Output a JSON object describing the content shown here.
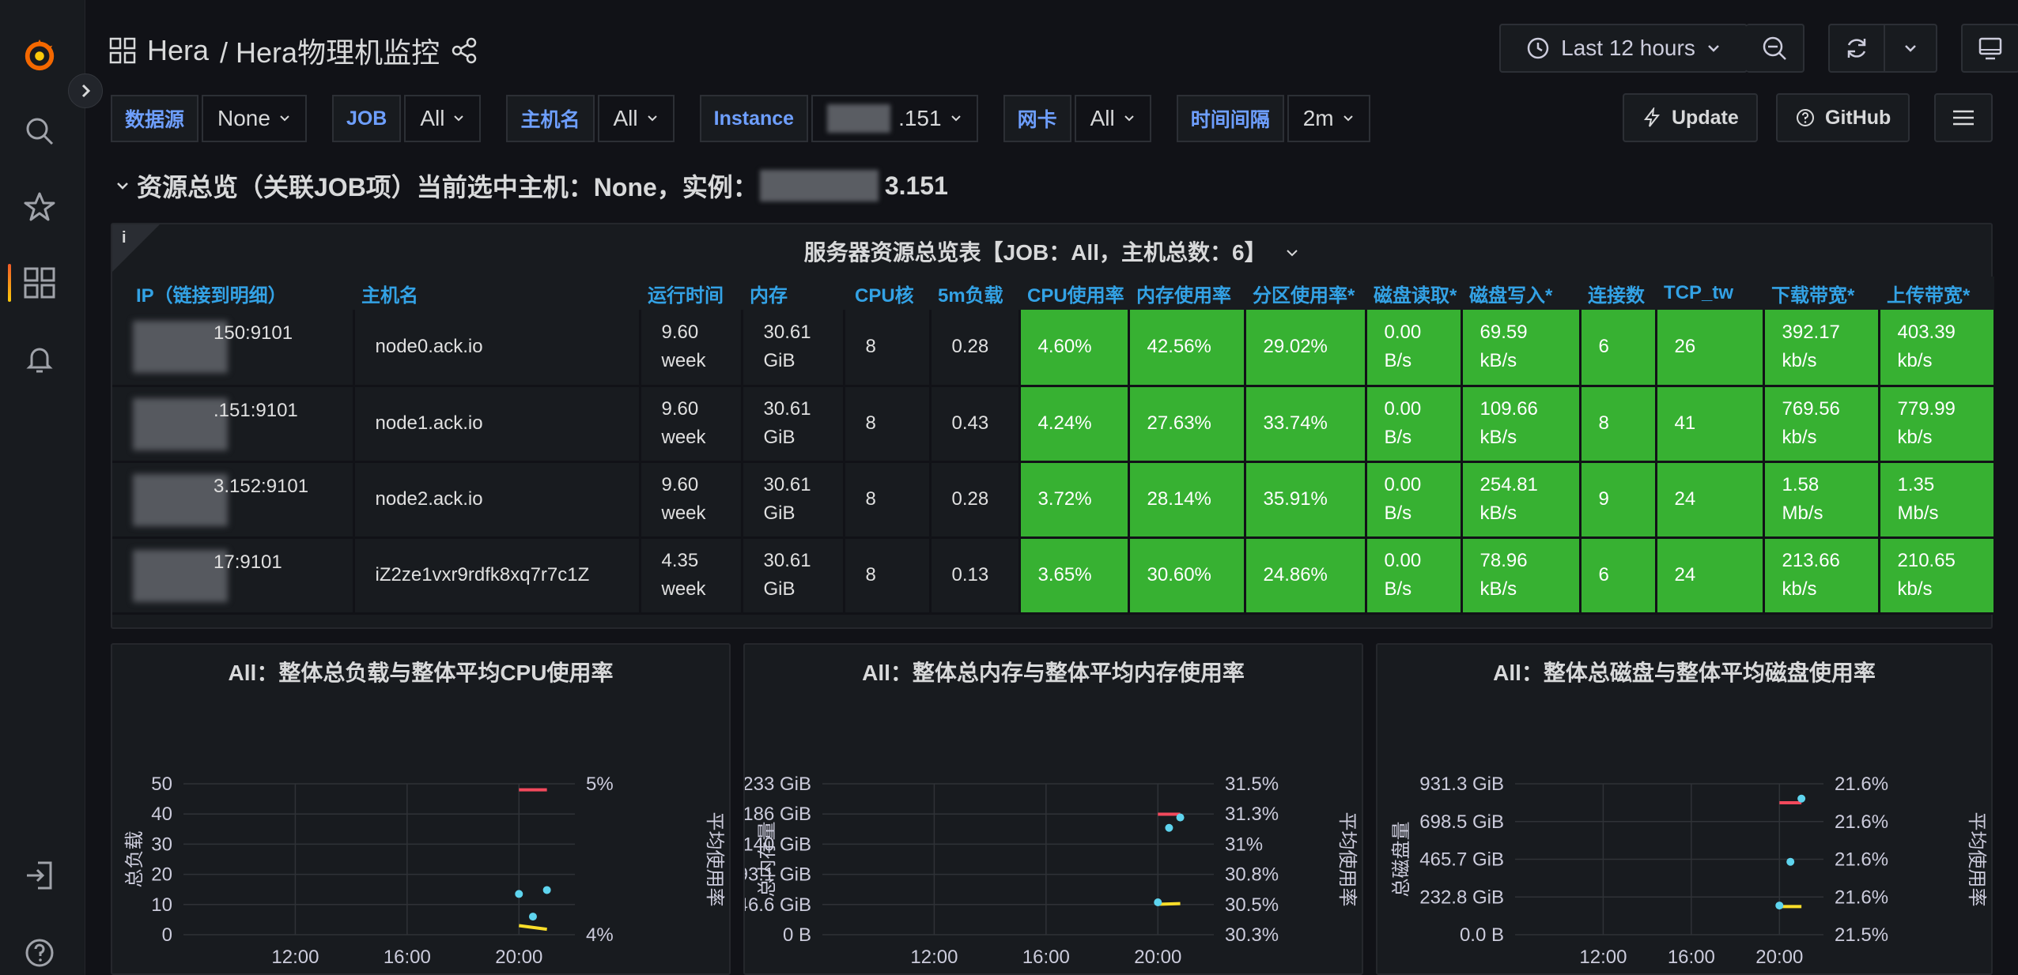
{
  "header": {
    "dashboard_folder": "Hera",
    "dashboard_title": "/ Hera物理机监控",
    "time_range": "Last 12 hours"
  },
  "variables": [
    {
      "label": "数据源",
      "value": "None"
    },
    {
      "label": "JOB",
      "value": "All"
    },
    {
      "label": "主机名",
      "value": "All"
    },
    {
      "label": "Instance",
      "value": ".151"
    },
    {
      "label": "网卡",
      "value": "All"
    },
    {
      "label": "时间间隔",
      "value": "2m"
    }
  ],
  "actions": {
    "update": "Update",
    "github": "GitHub"
  },
  "row": {
    "title_prefix": "资源总览（关联JOB项）当前选中主机：None，实例：",
    "title_suffix": "3.151"
  },
  "table": {
    "title": "服务器资源总览表【JOB：All，主机总数：6】",
    "columns": [
      "IP（链接到明细）",
      "主机名",
      "运行时间",
      "内存",
      "CPU核",
      "5m负载",
      "CPU使用率",
      "内存使用率",
      "分区使用率*",
      "磁盘读取*",
      "磁盘写入*",
      "连接数",
      "TCP_tw",
      "下载带宽*",
      "上传带宽*"
    ],
    "rows": [
      {
        "ip": "150:9101",
        "host": "node0.ack.io",
        "uptime_1": "9.60",
        "uptime_2": "week",
        "mem_1": "30.61",
        "mem_2": "GiB",
        "cpu": "8",
        "load": "0.28",
        "cpu_pct": "4.60%",
        "mem_pct": "42.56%",
        "part_pct": "29.02%",
        "rd_1": "0.00",
        "rd_2": "B/s",
        "wr_1": "69.59",
        "wr_2": "kB/s",
        "conn": "6",
        "tw": "26",
        "dl_1": "392.17",
        "dl_2": "kb/s",
        "ul_1": "403.39",
        "ul_2": "kb/s"
      },
      {
        "ip": ".151:9101",
        "host": "node1.ack.io",
        "uptime_1": "9.60",
        "uptime_2": "week",
        "mem_1": "30.61",
        "mem_2": "GiB",
        "cpu": "8",
        "load": "0.43",
        "cpu_pct": "4.24%",
        "mem_pct": "27.63%",
        "part_pct": "33.74%",
        "rd_1": "0.00",
        "rd_2": "B/s",
        "wr_1": "109.66",
        "wr_2": "kB/s",
        "conn": "8",
        "tw": "41",
        "dl_1": "769.56",
        "dl_2": "kb/s",
        "ul_1": "779.99",
        "ul_2": "kb/s"
      },
      {
        "ip": "3.152:9101",
        "host": "node2.ack.io",
        "uptime_1": "9.60",
        "uptime_2": "week",
        "mem_1": "30.61",
        "mem_2": "GiB",
        "cpu": "8",
        "load": "0.28",
        "cpu_pct": "3.72%",
        "mem_pct": "28.14%",
        "part_pct": "35.91%",
        "rd_1": "0.00",
        "rd_2": "B/s",
        "wr_1": "254.81",
        "wr_2": "kB/s",
        "conn": "9",
        "tw": "24",
        "dl_1": "1.58",
        "dl_2": "Mb/s",
        "ul_1": "1.35",
        "ul_2": "Mb/s"
      },
      {
        "ip": "17:9101",
        "host": "iZ2ze1vxr9rdfk8xq7r7c1Z",
        "uptime_1": "4.35",
        "uptime_2": "week",
        "mem_1": "30.61",
        "mem_2": "GiB",
        "cpu": "8",
        "load": "0.13",
        "cpu_pct": "3.65%",
        "mem_pct": "30.60%",
        "part_pct": "24.86%",
        "rd_1": "0.00",
        "rd_2": "B/s",
        "wr_1": "78.96",
        "wr_2": "kB/s",
        "conn": "6",
        "tw": "24",
        "dl_1": "213.66",
        "dl_2": "kb/s",
        "ul_1": "210.65",
        "ul_2": "kb/s"
      }
    ],
    "cell_color": "#37b132"
  },
  "chart_data": [
    {
      "type": "line",
      "title": "All：整体总负载与整体平均CPU使用率",
      "ylabel": "总负载",
      "y2label": "平均使用率",
      "x_ticks": [
        "12:00",
        "16:00",
        "20:00"
      ],
      "y_ticks": [
        "50",
        "40",
        "30",
        "20",
        "10",
        "0"
      ],
      "y2_ticks": [
        "5%",
        "4%"
      ],
      "ylim": [
        0,
        50
      ],
      "series": [
        {
          "color": "#f2495c",
          "x": [
            20.0,
            21.0
          ],
          "y": [
            48,
            48
          ]
        },
        {
          "color": "#fade2a",
          "x": [
            20.0,
            21.0
          ],
          "y": [
            3,
            1.8
          ]
        }
      ],
      "points": {
        "color": "#5ed4ee",
        "x": [
          20.0,
          20.5,
          21.0
        ],
        "y": [
          13.5,
          6,
          14.8
        ]
      }
    },
    {
      "type": "line",
      "title": "All：整体总内存与整体平均内存使用率",
      "ylabel": "总内存量",
      "y2label": "平均使用率",
      "x_ticks": [
        "12:00",
        "16:00",
        "20:00"
      ],
      "y_ticks": [
        "233 GiB",
        "186 GiB",
        "140 GiB",
        "93.1 GiB",
        "46.6 GiB",
        "0 B"
      ],
      "y2_ticks": [
        "31.5%",
        "31.3%",
        "31%",
        "30.8%",
        "30.5%",
        "30.3%"
      ],
      "ylim": [
        0,
        233
      ],
      "series": [
        {
          "color": "#f2495c",
          "x": [
            20.0,
            20.8
          ],
          "y": [
            186,
            186
          ]
        },
        {
          "color": "#fade2a",
          "x": [
            20.0,
            20.8
          ],
          "y": [
            47,
            48
          ]
        }
      ],
      "points": {
        "color": "#5ed4ee",
        "x": [
          20.0,
          20.4,
          20.8
        ],
        "y": [
          50,
          165,
          181
        ]
      }
    },
    {
      "type": "line",
      "title": "All：整体总磁盘与整体平均磁盘使用率",
      "ylabel": "总磁盘量",
      "y2label": "平均使用率",
      "x_ticks": [
        "12:00",
        "16:00",
        "20:00"
      ],
      "y_ticks": [
        "931.3 GiB",
        "698.5 GiB",
        "465.7 GiB",
        "232.8 GiB",
        "0.0 B"
      ],
      "y2_ticks": [
        "21.6%",
        "21.6%",
        "21.6%",
        "21.6%",
        "21.5%"
      ],
      "ylim": [
        0,
        931.3
      ],
      "series": [
        {
          "color": "#f2495c",
          "x": [
            20.0,
            21.0
          ],
          "y": [
            814,
            814
          ]
        },
        {
          "color": "#fade2a",
          "x": [
            20.0,
            21.0
          ],
          "y": [
            174,
            174
          ]
        }
      ],
      "points": {
        "color": "#5ed4ee",
        "x": [
          20.0,
          20.5,
          21.0
        ],
        "y": [
          180,
          450,
          840
        ]
      }
    }
  ]
}
